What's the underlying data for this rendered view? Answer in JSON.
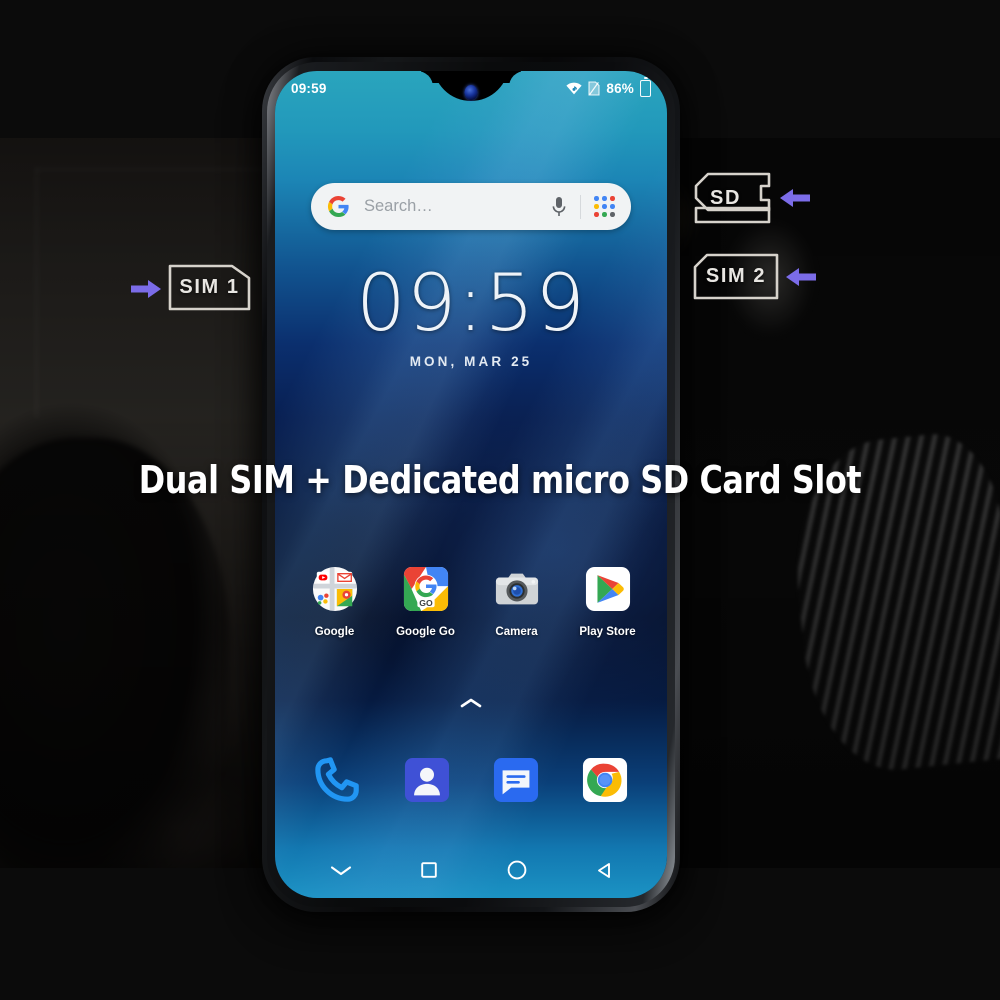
{
  "headline": "Dual SIM + Dedicated micro SD Card Slot",
  "phone": {
    "status_bar": {
      "time": "09:59",
      "battery_percent": "86%",
      "icons": [
        "wifi-icon",
        "sim-signal-icon",
        "battery-icon"
      ]
    },
    "search": {
      "placeholder": "Search…",
      "logo": "google-g-icon",
      "mic": "microphone-icon",
      "lens": "apps-grid-icon"
    },
    "clock": {
      "time": "09:59",
      "date": "MON, MAR 25"
    },
    "apps": [
      {
        "label": "Google",
        "icon": "google-folder-icon"
      },
      {
        "label": "Google Go",
        "icon": "google-go-icon"
      },
      {
        "label": "Camera",
        "icon": "camera-icon"
      },
      {
        "label": "Play Store",
        "icon": "play-store-icon"
      }
    ],
    "drawer_handle": "chevron-up-icon",
    "dock": [
      {
        "name": "phone-dialer",
        "icon": "phone-icon"
      },
      {
        "name": "contacts",
        "icon": "contacts-icon"
      },
      {
        "name": "messages",
        "icon": "messages-icon"
      },
      {
        "name": "chrome",
        "icon": "chrome-icon"
      }
    ],
    "nav_bar": [
      {
        "name": "hide-nav",
        "icon": "chevron-down-icon"
      },
      {
        "name": "recents",
        "icon": "square-icon"
      },
      {
        "name": "home",
        "icon": "circle-icon"
      },
      {
        "name": "back",
        "icon": "triangle-left-icon"
      }
    ]
  },
  "annotations": [
    {
      "id": "sim1",
      "label": "SIM  1",
      "arrow": "arrow-right-icon"
    },
    {
      "id": "sd",
      "label": "SD",
      "arrow": "arrow-left-icon"
    },
    {
      "id": "sim2",
      "label": "SIM  2",
      "arrow": "arrow-left-icon"
    }
  ],
  "colors": {
    "arrow": "#7b6ce8",
    "card_outline": "#d6d2cb",
    "headline_text": "#ffffff",
    "wallpaper_top": "#2aa5bd",
    "wallpaper_mid": "#061434",
    "wallpaper_bottom": "#1b93c4"
  }
}
